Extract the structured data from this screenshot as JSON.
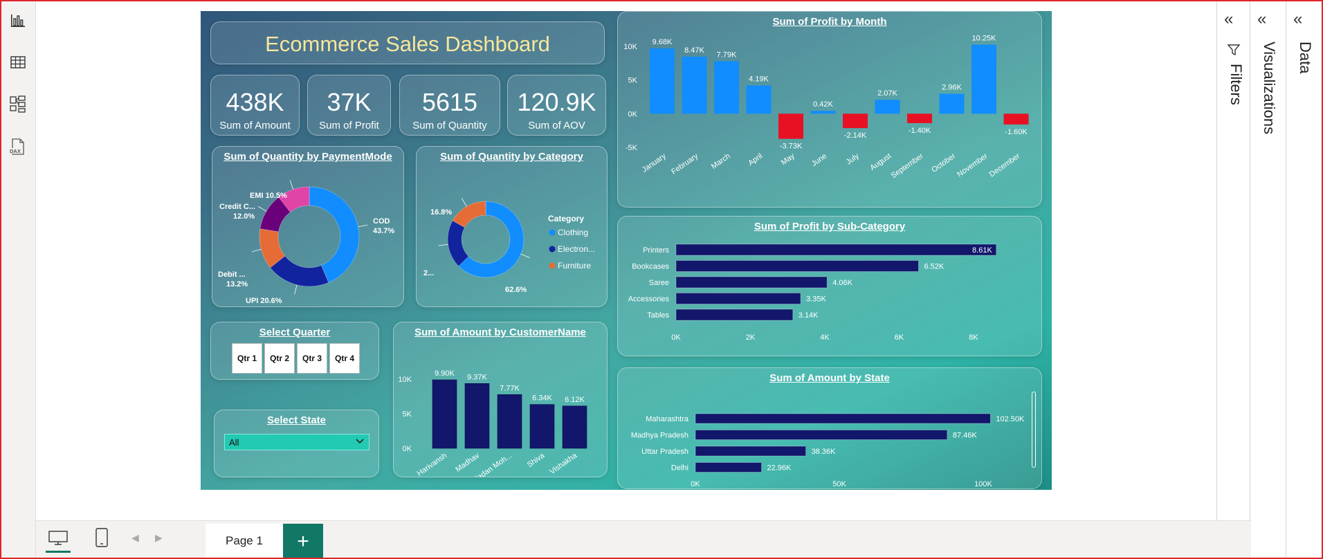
{
  "dashboard": {
    "title": "Ecommerce Sales Dashboard"
  },
  "kpis": [
    {
      "value": "438K",
      "label": "Sum of Amount"
    },
    {
      "value": "37K",
      "label": "Sum of Profit"
    },
    {
      "value": "5615",
      "label": "Sum of Quantity"
    },
    {
      "value": "120.9K",
      "label": "Sum of AOV"
    }
  ],
  "payment": {
    "title": "Sum of Quantity by PaymentMode"
  },
  "category": {
    "title": "Sum of Quantity by Category"
  },
  "quarter": {
    "title": "Select Quarter",
    "buttons": [
      "Qtr 1",
      "Qtr 2",
      "Qtr 3",
      "Qtr 4"
    ]
  },
  "state_filter": {
    "title": "Select State",
    "value": "All"
  },
  "customer": {
    "title": "Sum of Amount by CustomerName"
  },
  "profit_month": {
    "title": "Sum of Profit by Month"
  },
  "subcat": {
    "title": "Sum of Profit by Sub-Category"
  },
  "state_chart": {
    "title": "Sum of Amount by State"
  },
  "panes": {
    "filters": "Filters",
    "visualizations": "Visualizations",
    "data": "Data"
  },
  "pages": {
    "tab": "Page 1",
    "add": "+"
  },
  "colors": {
    "bar_blue": "#118dff",
    "bar_red": "#e81123",
    "bar_navy": "#12176b",
    "donut_cod": "#118dff",
    "donut_upi": "#12239e",
    "donut_debit": "#e66c37",
    "donut_credit": "#6b007b",
    "donut_emi": "#e044a7",
    "accent_green": "#117865"
  },
  "chart_data": [
    {
      "type": "pie",
      "variant": "donut",
      "title": "Sum of Quantity by PaymentMode",
      "slices": [
        {
          "name": "COD",
          "value": 43.7,
          "label": "COD",
          "pct": "43.7%"
        },
        {
          "name": "UPI",
          "value": 20.6,
          "label": "UPI",
          "pct": "20.6%"
        },
        {
          "name": "Debit Card",
          "value": 13.2,
          "label": "Debit ...",
          "pct": "13.2%"
        },
        {
          "name": "Credit Card",
          "value": 12.0,
          "label": "Credit C...",
          "pct": "12.0%"
        },
        {
          "name": "EMI",
          "value": 10.5,
          "label": "EMI",
          "pct": "10.5%"
        }
      ]
    },
    {
      "type": "pie",
      "variant": "donut",
      "title": "Sum of Quantity by Category",
      "legend_title": "Category",
      "legend": [
        "Clothing",
        "Electron...",
        "Furniture"
      ],
      "slices": [
        {
          "name": "Clothing",
          "value": 62.6,
          "pct": "62.6%"
        },
        {
          "name": "Electronics",
          "value": 20.6,
          "pct": "2..."
        },
        {
          "name": "Furniture",
          "value": 16.8,
          "pct": "16.8%"
        }
      ]
    },
    {
      "type": "bar",
      "title": "Sum of Amount by CustomerName",
      "categories": [
        "Harivansh",
        "Madhav",
        "Madan Moh...",
        "Shiva",
        "Vishakha"
      ],
      "values": [
        9900,
        9370,
        7770,
        6340,
        6120
      ],
      "labels": [
        "9.90K",
        "9.37K",
        "7.77K",
        "6.34K",
        "6.12K"
      ],
      "yticks": [
        "0K",
        "5K",
        "10K"
      ],
      "ylim": [
        0,
        10000
      ]
    },
    {
      "type": "bar",
      "title": "Sum of Profit by Month",
      "categories": [
        "January",
        "February",
        "March",
        "April",
        "May",
        "June",
        "July",
        "August",
        "September",
        "October",
        "November",
        "December"
      ],
      "values": [
        9680,
        8470,
        7790,
        4190,
        -3730,
        420,
        -2140,
        2070,
        -1400,
        2960,
        10250,
        -1600
      ],
      "labels": [
        "9.68K",
        "8.47K",
        "7.79K",
        "4.19K",
        "-3.73K",
        "0.42K",
        "-2.14K",
        "2.07K",
        "-1.40K",
        "2.96K",
        "10.25K",
        "-1.60K"
      ],
      "yticks": [
        "-5K",
        "0K",
        "5K",
        "10K"
      ],
      "ylim": [
        -5000,
        10000
      ]
    },
    {
      "type": "bar",
      "orientation": "horizontal",
      "title": "Sum of Profit by Sub-Category",
      "categories": [
        "Printers",
        "Bookcases",
        "Saree",
        "Accessories",
        "Tables"
      ],
      "values": [
        8610,
        6520,
        4060,
        3350,
        3140
      ],
      "labels": [
        "8.61K",
        "6.52K",
        "4.06K",
        "3.35K",
        "3.14K"
      ],
      "xticks": [
        "0K",
        "2K",
        "4K",
        "6K",
        "8K"
      ],
      "xlim": [
        0,
        8000
      ]
    },
    {
      "type": "bar",
      "orientation": "horizontal",
      "title": "Sum of Amount by State",
      "categories": [
        "Maharashtra",
        "Madhya Pradesh",
        "Uttar Pradesh",
        "Delhi"
      ],
      "values": [
        102500,
        87460,
        38360,
        22960
      ],
      "labels": [
        "102.50K",
        "87.46K",
        "38.36K",
        "22.96K"
      ],
      "xticks": [
        "0K",
        "50K",
        "100K"
      ],
      "xlim": [
        0,
        100000
      ]
    }
  ]
}
